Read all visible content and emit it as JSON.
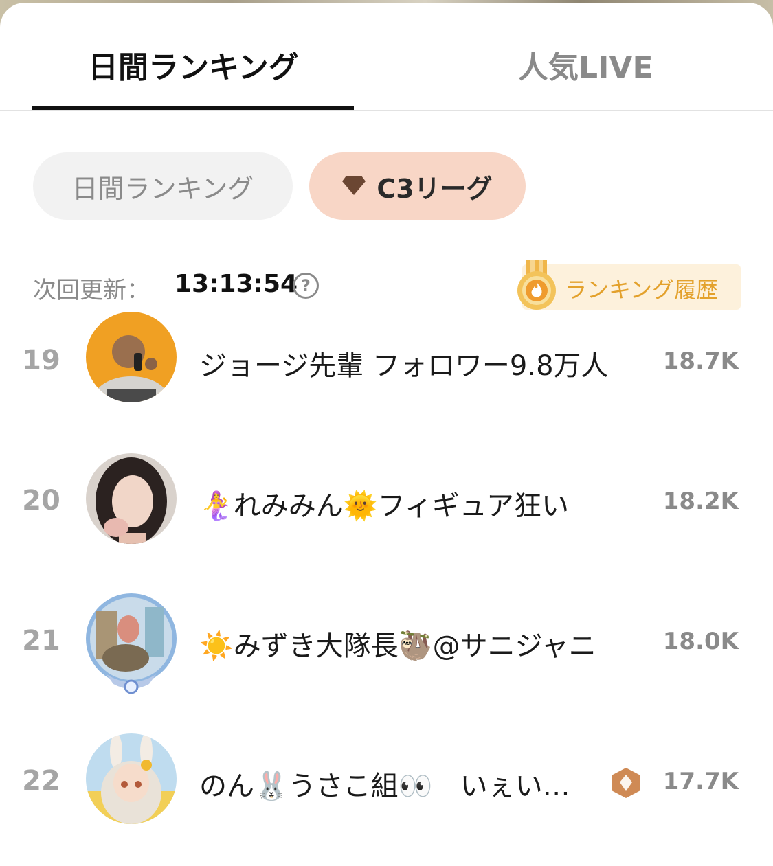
{
  "tabs": {
    "daily_label": "日間ランキング",
    "live_label": "人気LIVE"
  },
  "chips": {
    "daily_label": "日間ランキング",
    "league_label": "C3リーグ"
  },
  "update": {
    "label": "次回更新：",
    "time": "13:13:54"
  },
  "history": {
    "label": "ランキング履歴"
  },
  "ranking": [
    {
      "rank": "19",
      "name": "ジョージ先輩 フォロワー9.8万人",
      "score": "18.7K"
    },
    {
      "rank": "20",
      "name": "🧜‍♀️れみみん🌞フィギュア狂い",
      "score": "18.2K"
    },
    {
      "rank": "21",
      "name": "☀️みずき大隊長🦥@サニジャニ",
      "score": "18.0K"
    },
    {
      "rank": "22",
      "name": "のん🐰うさこ組👀　いぇい…",
      "score": "17.7K"
    }
  ],
  "colors": {
    "accent_chip": "#f8d6c6",
    "gem": "#6b4632",
    "history_text": "#e3a12c",
    "rank_gray": "#a5a5a5"
  }
}
